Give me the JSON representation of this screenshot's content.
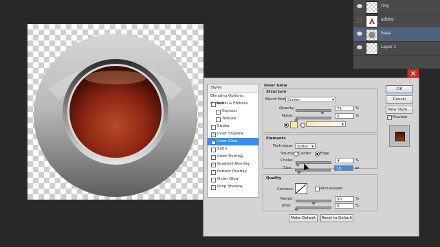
{
  "layers": [
    {
      "name": "ring",
      "visible": true,
      "selected": false
    },
    {
      "name": "adobe",
      "visible": false,
      "selected": false
    },
    {
      "name": "base",
      "visible": true,
      "selected": true
    },
    {
      "name": "Layer 1",
      "visible": true,
      "selected": false
    }
  ],
  "close_glyph": "✕",
  "dialog": {
    "styles_header": "Styles",
    "style_items": [
      {
        "label": "Blending Options: Default",
        "checkbox": false,
        "checked": false,
        "selected": false
      },
      {
        "label": "Bevel & Emboss",
        "checkbox": true,
        "checked": false,
        "selected": false
      },
      {
        "label": "Contour",
        "checkbox": true,
        "checked": false,
        "selected": false
      },
      {
        "label": "Texture",
        "checkbox": true,
        "checked": false,
        "selected": false
      },
      {
        "label": "Stroke",
        "checkbox": true,
        "checked": false,
        "selected": false
      },
      {
        "label": "Inner Shadow",
        "checkbox": true,
        "checked": true,
        "selected": false
      },
      {
        "label": "Inner Glow",
        "checkbox": true,
        "checked": true,
        "selected": true
      },
      {
        "label": "Satin",
        "checkbox": true,
        "checked": false,
        "selected": false
      },
      {
        "label": "Color Overlay",
        "checkbox": true,
        "checked": false,
        "selected": false
      },
      {
        "label": "Gradient Overlay",
        "checkbox": true,
        "checked": true,
        "selected": false
      },
      {
        "label": "Pattern Overlay",
        "checkbox": true,
        "checked": false,
        "selected": false
      },
      {
        "label": "Outer Glow",
        "checkbox": true,
        "checked": false,
        "selected": false
      },
      {
        "label": "Drop Shadow",
        "checkbox": true,
        "checked": false,
        "selected": false
      }
    ],
    "panel_title": "Inner Glow",
    "structure": {
      "title": "Structure",
      "blend_mode_label": "Blend Mode:",
      "blend_mode": "Screen",
      "opacity_label": "Opacity:",
      "opacity": "75",
      "noise_label": "Noise:",
      "noise": "0",
      "unit": "%",
      "glow_color": "#f8e7a6"
    },
    "elements": {
      "title": "Elements",
      "technique_label": "Technique:",
      "technique": "Softer",
      "source_label": "Source:",
      "source_center": "Center",
      "source_edge": "Edge",
      "choke_label": "Choke:",
      "choke": "4",
      "size_label": "Size:",
      "size": "10",
      "unit_pct": "%",
      "unit_px": "px"
    },
    "quality": {
      "title": "Quality",
      "contour_label": "Contour:",
      "anti_aliased": "Anti-aliased",
      "range_label": "Range:",
      "range": "50",
      "jitter_label": "Jitter:",
      "jitter": "0",
      "unit": "%"
    },
    "make_default": "Make Default",
    "reset_default": "Reset to Default",
    "ok": "OK",
    "cancel": "Cancel",
    "new_style": "New Style...",
    "preview": "Preview",
    "preview_checked": "✓"
  }
}
